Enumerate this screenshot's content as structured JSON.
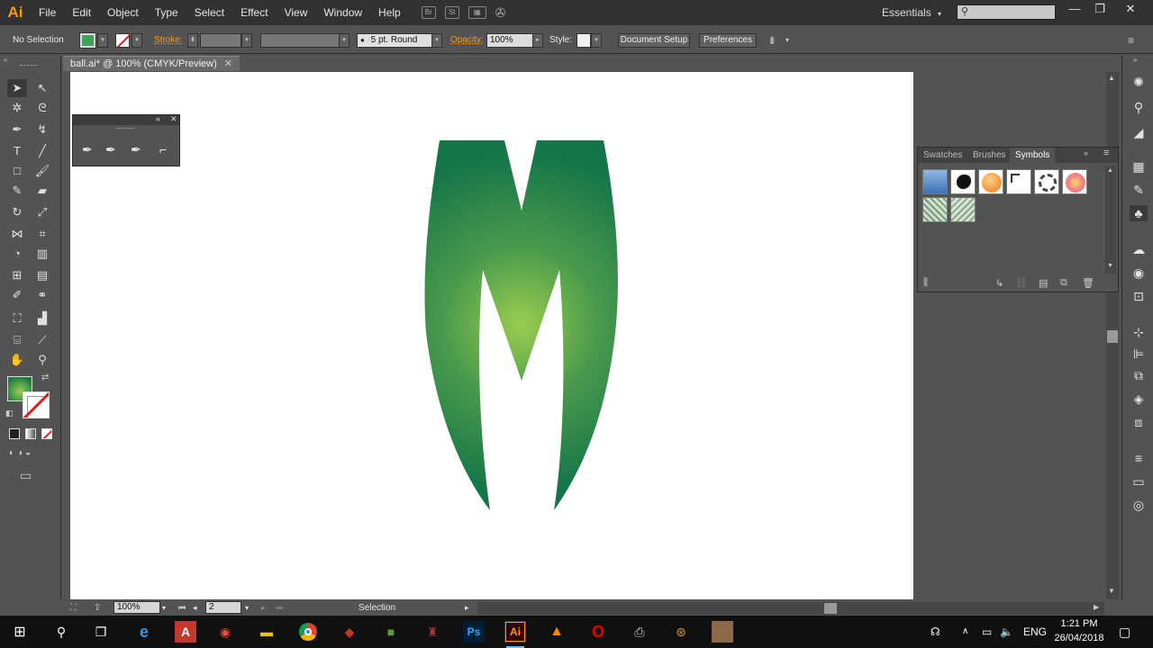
{
  "app": {
    "logo": "Ai"
  },
  "menu": [
    "File",
    "Edit",
    "Object",
    "Type",
    "Select",
    "Effect",
    "View",
    "Window",
    "Help"
  ],
  "header": {
    "workspace": "Essentials",
    "search_placeholder": ""
  },
  "control_bar": {
    "selection_status": "No Selection",
    "stroke_label": "Stroke:",
    "brush_value": "5 pt. Round",
    "opacity_label": "Opacity:",
    "opacity_value": "100%",
    "style_label": "Style:",
    "document_setup": "Document Setup",
    "preferences": "Preferences"
  },
  "document": {
    "tab_title": "ball.ai* @ 100% (CMYK/Preview)"
  },
  "panels": {
    "tabs": [
      "Swatches",
      "Brushes",
      "Symbols"
    ],
    "active_tab": "Symbols"
  },
  "status_bar": {
    "zoom": "100%",
    "artboard_number": "2",
    "current_tool": "Selection"
  },
  "taskbar": {
    "language": "ENG",
    "time": "1:21 PM",
    "date": "26/04/2018"
  },
  "colors": {
    "gradient_center": "#9acd50",
    "gradient_edge": "#147548",
    "app_accent": "#ff9a00"
  }
}
